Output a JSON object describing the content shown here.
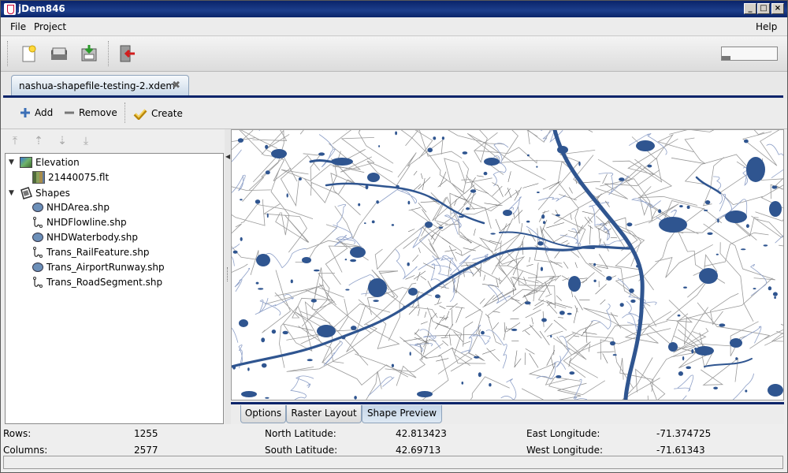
{
  "window": {
    "title": "jDem846"
  },
  "menu": {
    "file": "File",
    "project": "Project",
    "help": "Help"
  },
  "toolbar": {
    "memory_fraction": 0.15
  },
  "tab": {
    "label": "nashua-shapefile-testing-2.xdem"
  },
  "actions": {
    "add": "Add",
    "remove": "Remove",
    "create": "Create"
  },
  "tree": {
    "elevation": "Elevation",
    "elevation_file": "21440075.flt",
    "shapes": "Shapes",
    "shape_files": [
      {
        "label": "NHDArea.shp",
        "kind": "area"
      },
      {
        "label": "NHDFlowline.shp",
        "kind": "line"
      },
      {
        "label": "NHDWaterbody.shp",
        "kind": "area"
      },
      {
        "label": "Trans_RailFeature.shp",
        "kind": "line"
      },
      {
        "label": "Trans_AirportRunway.shp",
        "kind": "area"
      },
      {
        "label": "Trans_RoadSegment.shp",
        "kind": "line"
      }
    ]
  },
  "bottom_tabs": {
    "options": "Options",
    "raster": "Raster Layout",
    "preview": "Shape Preview",
    "selected": "preview"
  },
  "status": {
    "rows_label": "Rows:",
    "rows_value": "1255",
    "cols_label": "Columns:",
    "cols_value": "2577",
    "north_label": "North Latitude:",
    "north_value": "42.813423",
    "south_label": "South Latitude:",
    "south_value": "42.69713",
    "east_label": "East Longitude:",
    "east_value": "-71.374725",
    "west_label": "West Longitude:",
    "west_value": "-71.61343"
  },
  "colors": {
    "water": "#2f5590",
    "road": "#7f7f7f",
    "stream": "#8ea0c8",
    "titlebar": "#0a246a"
  }
}
